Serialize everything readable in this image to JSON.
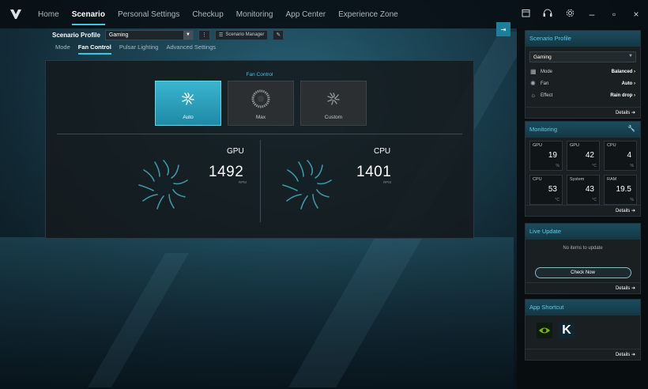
{
  "nav": {
    "tabs": [
      "Home",
      "Scenario",
      "Personal Settings",
      "Checkup",
      "Monitoring",
      "App Center",
      "Experience Zone"
    ],
    "active": "Scenario"
  },
  "window_controls": {
    "minimize": "–",
    "maximize": "▫",
    "close": "×"
  },
  "profile": {
    "label": "Scenario Profile",
    "value": "Gaming",
    "manager_label": "Scenario Manager"
  },
  "subtabs": [
    "Mode",
    "Fan Control",
    "Pulsar Lighting",
    "Advanced Settings"
  ],
  "fan_control": {
    "title": "Fan Control",
    "modes": [
      "Auto",
      "Max",
      "Custom"
    ],
    "active_mode": "Auto",
    "fans": [
      {
        "name": "GPU",
        "rpm": "1492",
        "unit": "RPM"
      },
      {
        "name": "CPU",
        "rpm": "1401",
        "unit": "RPM"
      }
    ]
  },
  "sidepanel": {
    "scenario_profile": {
      "title": "Scenario Profile",
      "selected": "Gaming",
      "rows": [
        {
          "icon": "mode-icon",
          "label": "Mode",
          "value": "Balanced ›"
        },
        {
          "icon": "fan-icon",
          "label": "Fan",
          "value": "Auto ›"
        },
        {
          "icon": "effect-icon",
          "label": "Effect",
          "value": "Rain drop ›"
        }
      ],
      "details": "Details ➔"
    },
    "monitoring": {
      "title": "Monitoring",
      "cells": [
        {
          "label": "GPU",
          "value": "19",
          "unit": "%"
        },
        {
          "label": "GPU",
          "value": "42",
          "unit": "°C"
        },
        {
          "label": "CPU",
          "value": "4",
          "unit": "%"
        },
        {
          "label": "CPU",
          "value": "53",
          "unit": "°C"
        },
        {
          "label": "System",
          "value": "43",
          "unit": "°C"
        },
        {
          "label": "RAM",
          "value": "19.5",
          "unit": "%"
        }
      ],
      "details": "Details ➔"
    },
    "live_update": {
      "title": "Live Update",
      "message": "No items to update",
      "button": "Check Now",
      "details": "Details ➔"
    },
    "app_shortcut": {
      "title": "App Shortcut",
      "apps": [
        "nvidia-icon",
        "killer-icon"
      ],
      "killer_letter": "K",
      "details": "Details ➔"
    }
  },
  "colors": {
    "accent": "#36c8e8",
    "active_card": "#2aa6c4"
  }
}
